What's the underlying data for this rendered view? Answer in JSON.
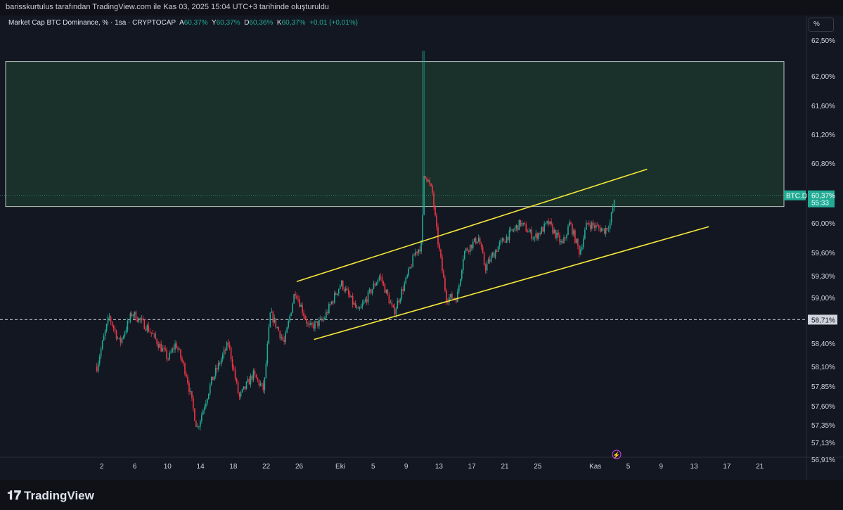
{
  "header": {
    "caption": "barisskurtulus tarafından TradingView.com ile Kas 03, 2025 15:04 UTC+3 tarihinde oluşturuldu"
  },
  "legend": {
    "title": "Market Cap BTC Dominance, % · 1sa · CRYPTOCAP",
    "o_label": "A",
    "o": "60,37%",
    "h_label": "Y",
    "h": "60,37%",
    "l_label": "D",
    "l": "60,36%",
    "c_label": "K",
    "c": "60,37%",
    "change": "+0,01 (+0,01%)"
  },
  "scale_button": "%",
  "footer": {
    "brand": "TradingView"
  },
  "colors": {
    "up": "#22ab94",
    "down": "#f23645",
    "channel": "#f5e83a",
    "zone": "#1e3a2e",
    "bg": "#131722"
  },
  "chart_data": {
    "type": "candlestick",
    "symbol_tag": "BTC.D",
    "last_price": 60.37,
    "last_price_label": "60,37%",
    "countdown": "55:33",
    "dashed_level": 58.71,
    "dashed_label": "58,71%",
    "y_ticks": [
      62.5,
      62.0,
      61.6,
      61.2,
      60.8,
      60.0,
      59.6,
      59.3,
      59.0,
      58.4,
      58.1,
      57.85,
      57.6,
      57.35,
      57.13,
      56.91
    ],
    "y_tick_labels": [
      "62,50%",
      "62,00%",
      "61,60%",
      "61,20%",
      "60,80%",
      "60,00%",
      "59,60%",
      "59,30%",
      "59,00%",
      "58,40%",
      "58,10%",
      "57,85%",
      "57,60%",
      "57,35%",
      "57,13%",
      "56,91%"
    ],
    "x_ticks": [
      {
        "day": 1,
        "label": "2"
      },
      {
        "day": 5,
        "label": "6"
      },
      {
        "day": 9,
        "label": "10"
      },
      {
        "day": 13,
        "label": "14"
      },
      {
        "day": 17,
        "label": "18"
      },
      {
        "day": 21,
        "label": "22"
      },
      {
        "day": 25,
        "label": "26"
      },
      {
        "day": 30,
        "label": "Eki"
      },
      {
        "day": 34,
        "label": "5"
      },
      {
        "day": 38,
        "label": "9"
      },
      {
        "day": 42,
        "label": "13"
      },
      {
        "day": 46,
        "label": "17"
      },
      {
        "day": 50,
        "label": "21"
      },
      {
        "day": 54,
        "label": "25"
      },
      {
        "day": 61,
        "label": "Kas"
      },
      {
        "day": 65,
        "label": "5"
      },
      {
        "day": 69,
        "label": "9"
      },
      {
        "day": 73,
        "label": "13"
      },
      {
        "day": 77,
        "label": "17"
      },
      {
        "day": 81,
        "label": "21"
      }
    ],
    "path": [
      [
        0.4,
        58.1
      ],
      [
        1.9,
        58.75
      ],
      [
        3.2,
        58.4
      ],
      [
        4.7,
        58.8
      ],
      [
        6.6,
        58.6
      ],
      [
        9.1,
        58.2
      ],
      [
        10,
        58.4
      ],
      [
        11.3,
        58.0
      ],
      [
        12.6,
        57.3
      ],
      [
        14.3,
        57.9
      ],
      [
        16.4,
        58.4
      ],
      [
        17.7,
        57.7
      ],
      [
        19.4,
        58.0
      ],
      [
        20.7,
        57.8
      ],
      [
        21.5,
        58.8
      ],
      [
        23.2,
        58.4
      ],
      [
        24.5,
        59.1
      ],
      [
        26.2,
        58.6
      ],
      [
        27.9,
        58.7
      ],
      [
        30.1,
        59.2
      ],
      [
        32.2,
        58.8
      ],
      [
        34.8,
        59.3
      ],
      [
        36.5,
        58.8
      ],
      [
        38.2,
        59.3
      ],
      [
        39.1,
        59.6
      ],
      [
        39.9,
        59.7
      ],
      [
        40.2,
        60.7
      ],
      [
        41.2,
        60.4
      ],
      [
        41.8,
        59.8
      ],
      [
        42.9,
        59.0
      ],
      [
        44.2,
        59.0
      ],
      [
        45,
        59.6
      ],
      [
        46.8,
        59.8
      ],
      [
        47.6,
        59.4
      ],
      [
        49.3,
        59.7
      ],
      [
        51.9,
        60.0
      ],
      [
        53.6,
        59.8
      ],
      [
        55.3,
        60.0
      ],
      [
        57,
        59.7
      ],
      [
        57.9,
        60.0
      ],
      [
        59.1,
        59.6
      ],
      [
        60,
        60.0
      ],
      [
        62.1,
        59.9
      ],
      [
        62.8,
        60.0
      ],
      [
        63.4,
        60.37
      ]
    ],
    "spike": {
      "day": 40.1,
      "high": 62.35
    },
    "zone": {
      "top": 62.2,
      "bottom": 60.22
    },
    "channel_upper": [
      [
        24.7,
        59.22
      ],
      [
        67.3,
        60.72
      ]
    ],
    "channel_lower": [
      [
        26.8,
        58.45
      ],
      [
        74.8,
        59.95
      ]
    ]
  }
}
